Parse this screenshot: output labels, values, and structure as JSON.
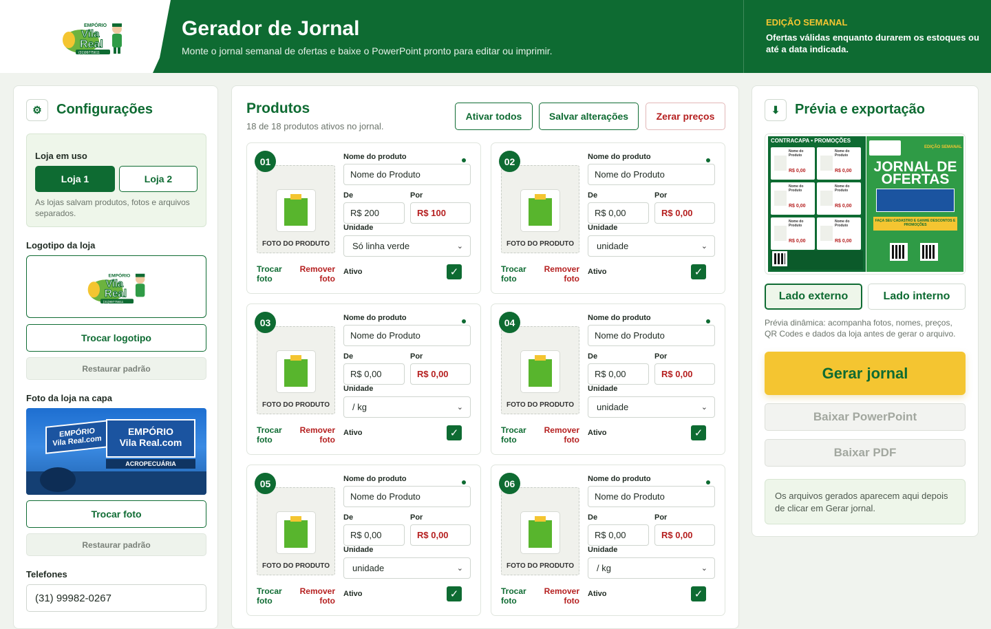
{
  "header": {
    "brand_top": "EMPÓRIO",
    "brand_name_1": "Vila",
    "brand_name_2": "Real",
    "brand_phone": "(31)99775611",
    "title": "Gerador de Jornal",
    "subtitle": "Monte o jornal semanal de ofertas e baixe o PowerPoint pronto para editar ou imprimir.",
    "edition": "EDIÇÃO SEMANAL",
    "note": "Ofertas válidas enquanto durarem os estoques ou até a data indicada."
  },
  "config": {
    "title": "Configurações",
    "store_label": "Loja em uso",
    "store_1": "Loja 1",
    "store_2": "Loja 2",
    "store_hint": "As lojas salvam produtos, fotos e arquivos separados.",
    "logo_label": "Logotipo da loja",
    "swap_logo": "Trocar logotipo",
    "restore_1": "Restaurar padrão",
    "photo_label": "Foto da loja na capa",
    "store_sign_1": "EMPÓRIO",
    "store_sign_2": "Vila Real.com",
    "store_sign_3": "ACROPECUÁRIA",
    "swap_photo": "Trocar foto",
    "restore_2": "Restaurar padrão",
    "phones_label": "Telefones",
    "phone_value": "(31) 99982-0267"
  },
  "products": {
    "title": "Produtos",
    "subtitle": "18 de 18 produtos ativos no jornal.",
    "activate_all": "Ativar todos",
    "save": "Salvar alterações",
    "reset_prices": "Zerar preços",
    "labels": {
      "name": "Nome do produto",
      "from": "De",
      "to": "Por",
      "unit": "Unidade",
      "active": "Ativo",
      "photo": "FOTO DO PRODUTO",
      "swap": "Trocar foto",
      "remove": "Remover foto"
    },
    "items": [
      {
        "num": "01",
        "name": "Nome do Produto",
        "from": "R$ 200",
        "to": "R$ 100",
        "unit": "Só linha verde"
      },
      {
        "num": "02",
        "name": "Nome do Produto",
        "from": "R$ 0,00",
        "to": "R$ 0,00",
        "unit": "unidade"
      },
      {
        "num": "03",
        "name": "Nome do Produto",
        "from": "R$ 0,00",
        "to": "R$ 0,00",
        "unit": "/ kg"
      },
      {
        "num": "04",
        "name": "Nome do Produto",
        "from": "R$ 0,00",
        "to": "R$ 0,00",
        "unit": "unidade"
      },
      {
        "num": "05",
        "name": "Nome do Produto",
        "from": "R$ 0,00",
        "to": "R$ 0,00",
        "unit": "unidade"
      },
      {
        "num": "06",
        "name": "Nome do Produto",
        "from": "R$ 0,00",
        "to": "R$ 0,00",
        "unit": "/ kg"
      }
    ]
  },
  "preview": {
    "title": "Prévia e exportação",
    "back_cover": "CONTRACAPA • PROMOÇÕES",
    "cell_name": "Nome do Produto",
    "cell_price": "R$ 0,00",
    "paper_edition": "EDIÇÃO SEMANAL",
    "paper_title": "JORNAL DE OFERTAS",
    "paper_band": "FAÇA SEU CADASTRO E GANHE DESCONTOS E PROMOÇÕES",
    "outer": "Lado externo",
    "inner": "Lado interno",
    "hint": "Prévia dinâmica: acompanha fotos, nomes, preços, QR Codes e dados da loja antes de gerar o arquivo.",
    "generate": "Gerar jornal",
    "download_ppt": "Baixar PowerPoint",
    "download_pdf": "Baixar PDF",
    "files_note": "Os arquivos gerados aparecem aqui depois de clicar em Gerar jornal."
  },
  "colors": {
    "primary": "#0e6b32",
    "accent": "#f4c531",
    "price_red": "#b51f1f"
  }
}
